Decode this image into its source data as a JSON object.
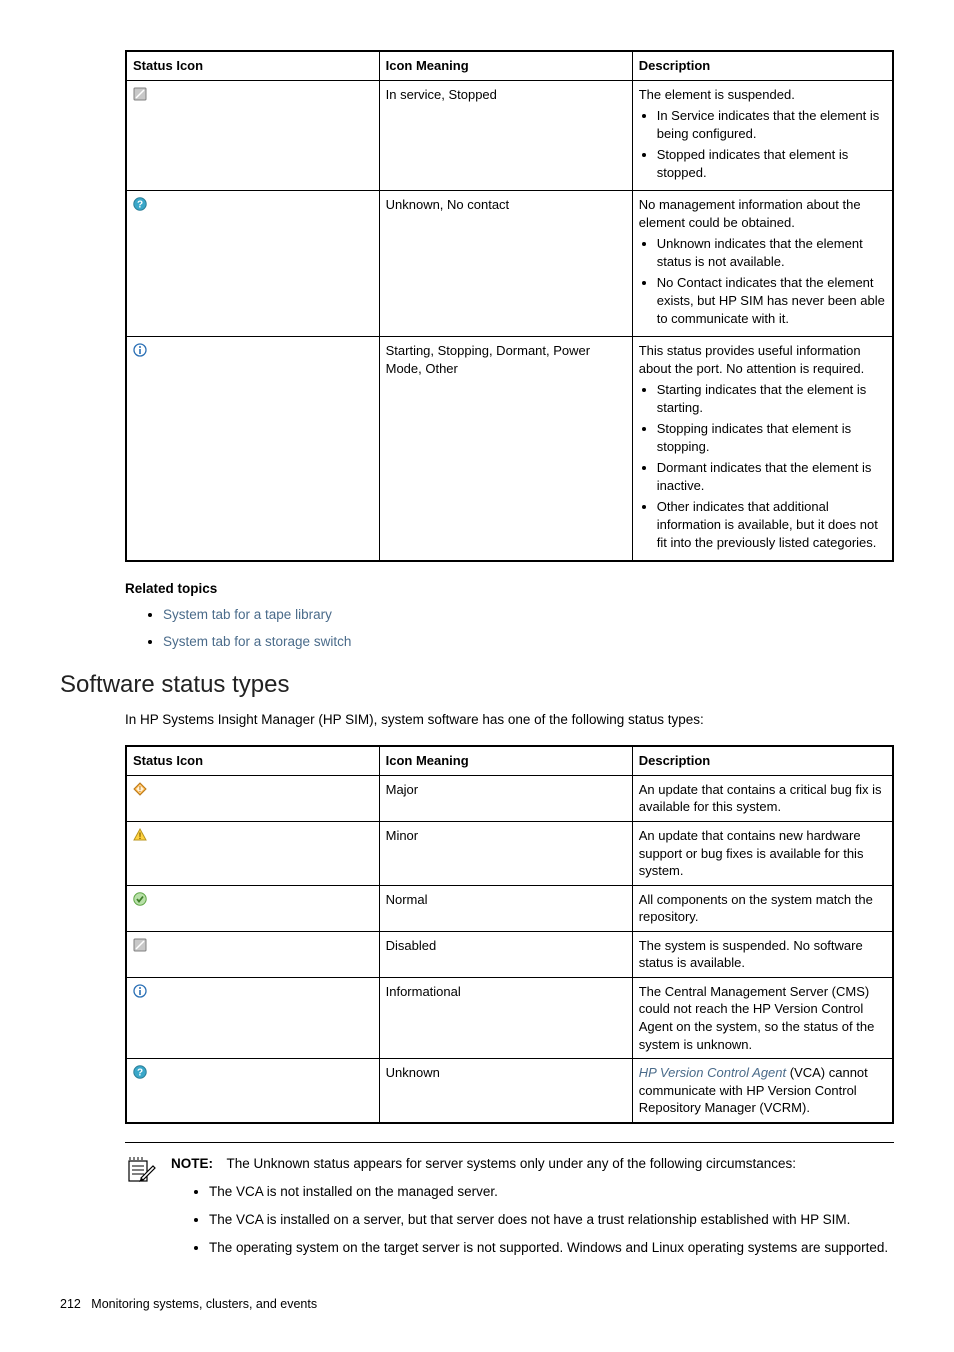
{
  "table1": {
    "headers": [
      "Status Icon",
      "Icon Meaning",
      "Description"
    ],
    "rows": [
      {
        "icon": "suspended",
        "meaning": "In service, Stopped",
        "desc_intro": "The element is suspended.",
        "bullets": [
          "In Service indicates that the element is being configured.",
          "Stopped indicates that element is stopped."
        ]
      },
      {
        "icon": "unknown",
        "meaning": "Unknown, No contact",
        "desc_intro": "No management information about the element could be obtained.",
        "bullets": [
          "Unknown indicates that the element status is not available.",
          "No Contact indicates that the element exists, but HP SIM has never been able to communicate with it."
        ]
      },
      {
        "icon": "info",
        "meaning": "Starting, Stopping, Dormant, Power Mode, Other",
        "desc_intro": "This status provides useful information about the port. No attention is required.",
        "bullets": [
          "Starting indicates that the element is starting.",
          "Stopping indicates that element is stopping.",
          "Dormant indicates that the element is inactive.",
          "Other indicates that additional information is available, but it does not fit into the previously listed categories."
        ]
      }
    ]
  },
  "related": {
    "heading": "Related topics",
    "links": [
      "System tab for a tape library",
      "System tab for a storage switch"
    ]
  },
  "section": {
    "heading": "Software status types",
    "intro": "In HP Systems Insight Manager (HP SIM), system software has one of the following status types:"
  },
  "table2": {
    "headers": [
      "Status Icon",
      "Icon Meaning",
      "Description"
    ],
    "rows": [
      {
        "icon": "major",
        "meaning": "Major",
        "desc": "An update that contains a critical bug fix is available for this system."
      },
      {
        "icon": "minor",
        "meaning": "Minor",
        "desc": "An update that contains new hardware support or bug fixes is available for this system."
      },
      {
        "icon": "normal",
        "meaning": "Normal",
        "desc": "All components on the system match the repository."
      },
      {
        "icon": "suspended",
        "meaning": "Disabled",
        "desc": "The system is suspended. No software status is available."
      },
      {
        "icon": "info",
        "meaning": "Informational",
        "desc": "The Central Management Server (CMS) could not reach the HP Version Control Agent on the system, so the status of the system is unknown."
      },
      {
        "icon": "unknown",
        "meaning": "Unknown",
        "link_text": "HP Version Control Agent",
        "desc_tail": " (VCA) cannot communicate with HP Version Control Repository Manager (VCRM)."
      }
    ]
  },
  "note": {
    "label": "NOTE:",
    "lead": "The Unknown status appears for server systems only under any of the following circumstances:",
    "bullets": [
      "The VCA is not installed on the managed server.",
      "The VCA is installed on a server, but that server does not have a trust relationship established with HP SIM.",
      "The operating system on the target server is not supported. Windows and Linux operating systems are supported."
    ]
  },
  "footer": {
    "page": "212",
    "text": "Monitoring systems, clusters, and events"
  }
}
